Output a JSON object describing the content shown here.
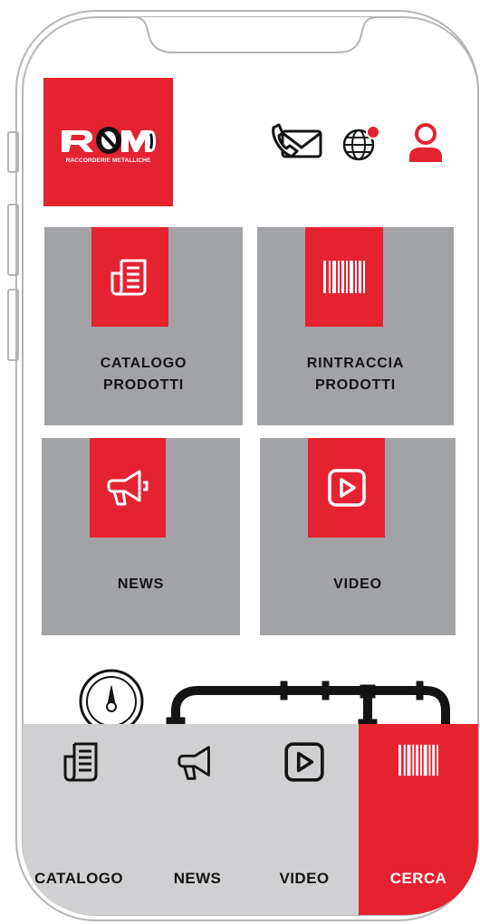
{
  "brand": {
    "logo_letters": "RM",
    "logo_tagline": "RACCORDERIE METALLICHE"
  },
  "header": {
    "icons": [
      "phone-mail-icon",
      "globe-icon",
      "user-icon"
    ],
    "notification_badge": true
  },
  "tiles": [
    {
      "label_line1": "CATALOGO",
      "label_line2": "PRODOTTI",
      "icon": "catalog-icon"
    },
    {
      "label_line1": "RINTRACCIA",
      "label_line2": "PRODOTTI",
      "icon": "barcode-icon"
    },
    {
      "label_line1": "NEWS",
      "icon": "megaphone-icon"
    },
    {
      "label_line1": "VIDEO",
      "icon": "play-icon"
    }
  ],
  "tab_bar": {
    "items": [
      {
        "label": "CATALOGO",
        "icon": "catalog-icon"
      },
      {
        "label": "NEWS",
        "icon": "megaphone-icon"
      },
      {
        "label": "VIDEO",
        "icon": "play-icon"
      },
      {
        "label": "CERCA",
        "icon": "barcode-icon",
        "active": true
      }
    ]
  },
  "colors": {
    "accent": "#e52330",
    "tile_gray": "#a2a3a7",
    "tab_bar_gray": "#d0d0d2",
    "text_dark": "#141414"
  }
}
